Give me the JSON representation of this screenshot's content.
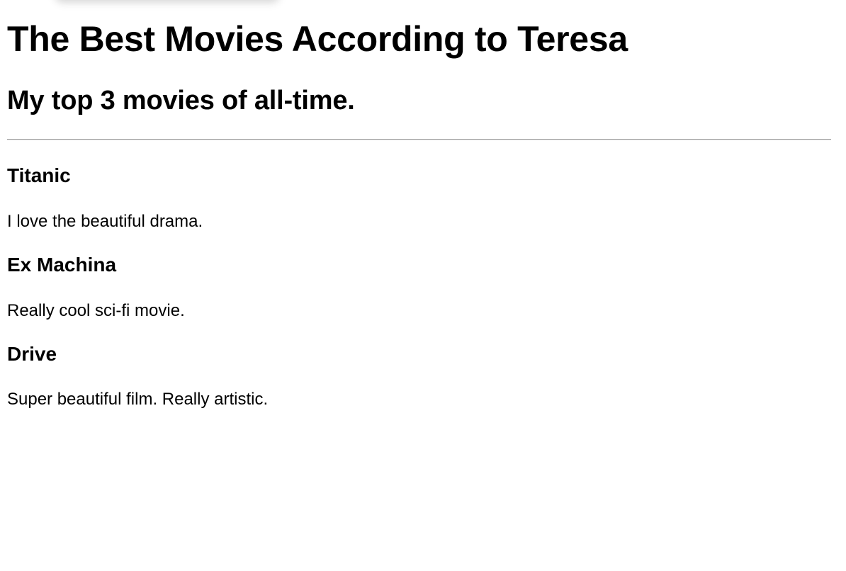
{
  "page": {
    "title": "The Best Movies According to Teresa",
    "subtitle": "My top 3 movies of all-time."
  },
  "movies": [
    {
      "title": "Titanic",
      "description": "I love the beautiful drama."
    },
    {
      "title": "Ex Machina",
      "description": "Really cool sci-fi movie."
    },
    {
      "title": "Drive",
      "description": "Super beautiful film. Really artistic."
    }
  ]
}
